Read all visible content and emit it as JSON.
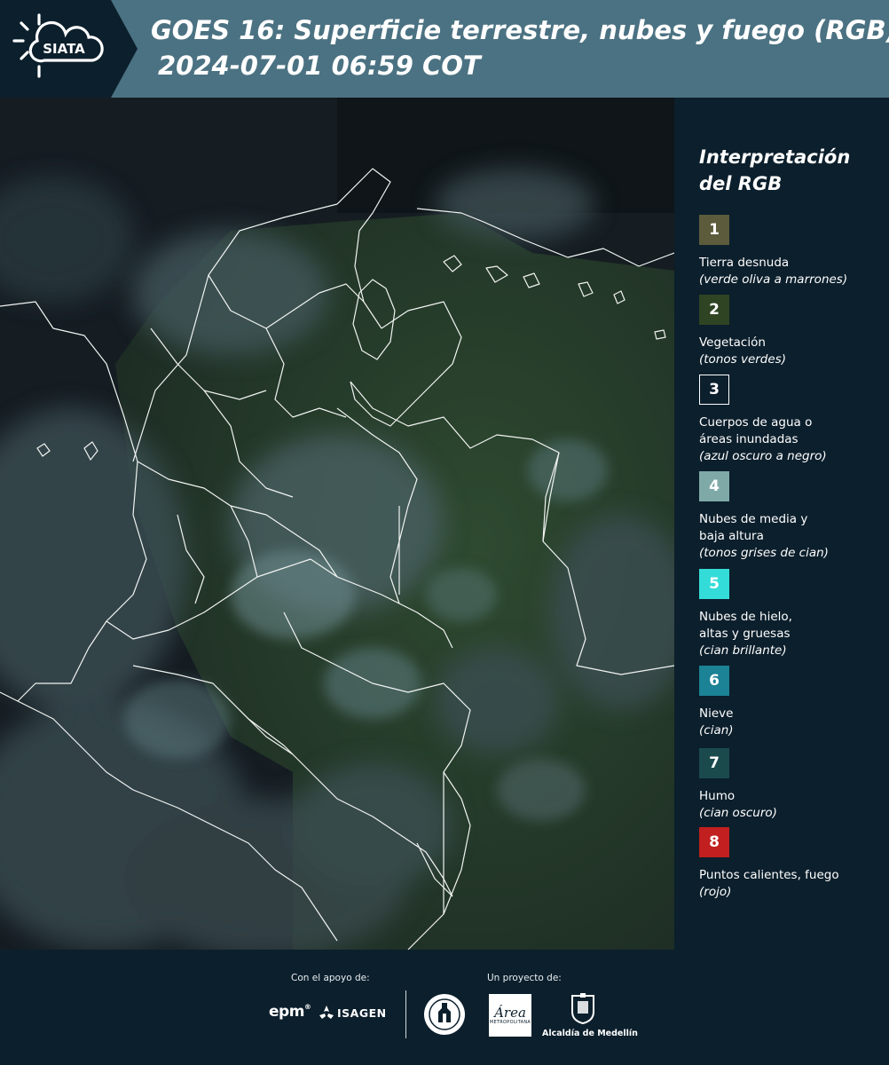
{
  "header": {
    "logo_text": "SIATA",
    "title_line1": "GOES 16: Superficie terrestre, nubes y fuego (RGB)",
    "title_line2": "2024-07-01 06:59 COT"
  },
  "legend": {
    "title": "Interpretación del RGB",
    "items": [
      {
        "number": "1",
        "label": "Tierra desnuda",
        "note": "(verde oliva a marrones)",
        "color": "#5c5b3c"
      },
      {
        "number": "2",
        "label": "Vegetación",
        "note": "(tonos verdes)",
        "color": "#2f4423"
      },
      {
        "number": "3",
        "label": "Cuerpos de agua o áreas inundadas",
        "note": "(azul oscuro a negro)",
        "color": "#0c1f2c"
      },
      {
        "number": "4",
        "label": "Nubes de media y baja altura",
        "note": "(tonos grises de cian)",
        "color": "#7fa9a7"
      },
      {
        "number": "5",
        "label": "Nubes de hielo, altas y gruesas",
        "note": "(cian brillante)",
        "color": "#33dcd8"
      },
      {
        "number": "6",
        "label": "Nieve",
        "note": "(cian)",
        "color": "#1c8295"
      },
      {
        "number": "7",
        "label": "Humo",
        "note": "(cian oscuro)",
        "color": "#1b4a4d"
      },
      {
        "number": "8",
        "label": "Puntos calientes, fuego",
        "note": "(rojo)",
        "color": "#c21f20"
      }
    ]
  },
  "footer": {
    "support_caption": "Con el apoyo de:",
    "project_caption": "Un proyecto de:",
    "epm_text": "epm",
    "isagen_text": "ISAGEN",
    "area_text": "Área",
    "area_subtext": "METROPOLITANA",
    "alcaldia_text": "Alcaldía de Medellín"
  }
}
